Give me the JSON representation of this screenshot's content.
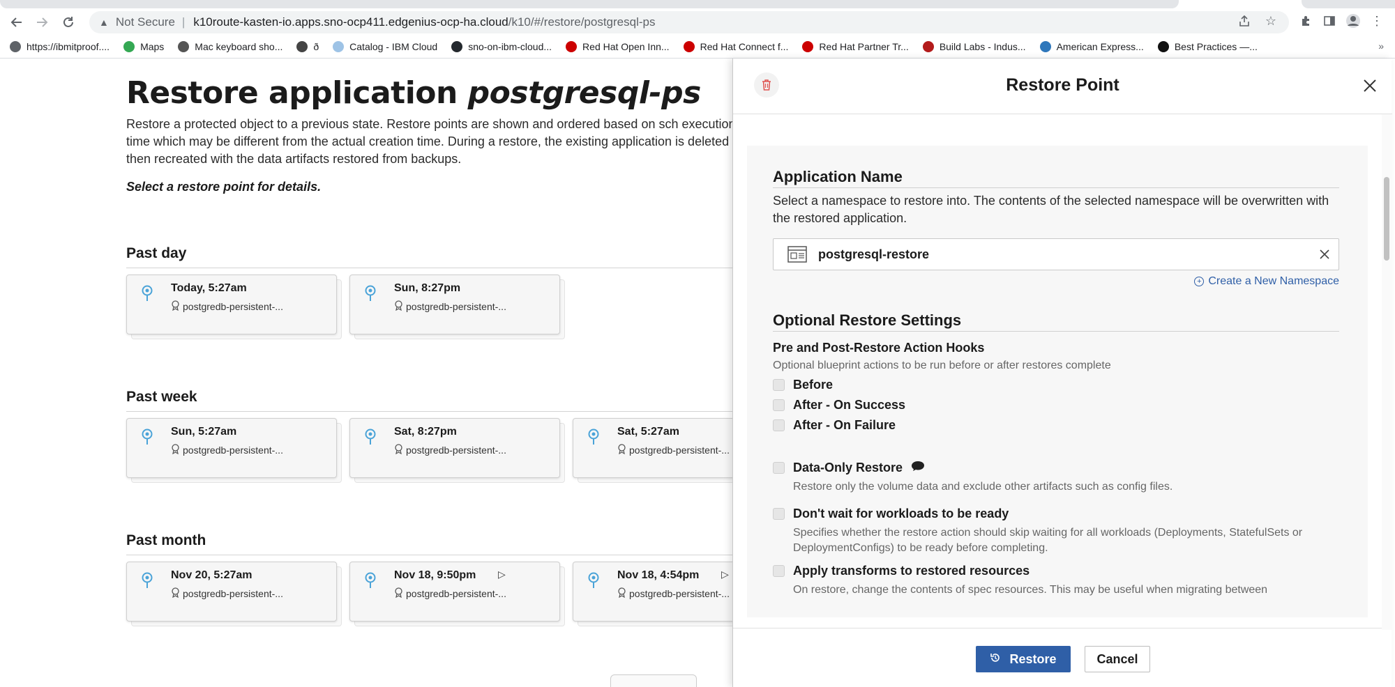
{
  "browser": {
    "security_label": "Not Secure",
    "url_host": "k10route-kasten-io.apps.sno-ocp411.edgenius-ocp-ha.cloud",
    "url_path": "/k10/#/restore/postgresql-ps",
    "bookmarks": [
      {
        "label": "https://ibmitproof....",
        "icon_color": "#5f6368"
      },
      {
        "label": "Maps",
        "icon_color": "#34a853"
      },
      {
        "label": "Mac keyboard sho...",
        "icon_color": "#555555"
      },
      {
        "label": "ð",
        "icon_color": "#444444"
      },
      {
        "label": "Catalog - IBM Cloud",
        "icon_color": "#9ec3e6"
      },
      {
        "label": "sno-on-ibm-cloud...",
        "icon_color": "#24292e"
      },
      {
        "label": "Red Hat Open Inn...",
        "icon_color": "#cc0000"
      },
      {
        "label": "Red Hat Connect f...",
        "icon_color": "#cc0000"
      },
      {
        "label": "Red Hat Partner Tr...",
        "icon_color": "#cc0000"
      },
      {
        "label": "Build Labs - Indus...",
        "icon_color": "#b31b1b"
      },
      {
        "label": "American Express...",
        "icon_color": "#2e77bb"
      },
      {
        "label": "Best Practices —...",
        "icon_color": "#111111"
      }
    ],
    "more_label": "»"
  },
  "page": {
    "title_prefix": "Restore application",
    "title_app": "postgresql-ps",
    "description": "Restore a protected object to a previous state. Restore points are shown and ordered based on sch execution time which may be different from the actual creation time. During a restore, the existing application is deleted and then recreated with the data artifacts restored from backups.",
    "select_hint": "Select a restore point for details.",
    "sections": [
      {
        "heading": "Past day",
        "cards": [
          {
            "time": "Today, 5:27am",
            "sub": "postgredb-persistent-...",
            "play": false
          },
          {
            "time": "Sun, 8:27pm",
            "sub": "postgredb-persistent-...",
            "play": false
          }
        ]
      },
      {
        "heading": "Past week",
        "cards": [
          {
            "time": "Sun, 5:27am",
            "sub": "postgredb-persistent-...",
            "play": false
          },
          {
            "time": "Sat, 8:27pm",
            "sub": "postgredb-persistent-...",
            "play": false
          },
          {
            "time": "Sat, 5:27am",
            "sub": "postgredb-persistent-...",
            "play": false
          }
        ]
      },
      {
        "heading": "Past month",
        "cards": [
          {
            "time": "Nov 20, 5:27am",
            "sub": "postgredb-persistent-...",
            "play": false
          },
          {
            "time": "Nov 18, 9:50pm",
            "sub": "postgredb-persistent-...",
            "play": true
          },
          {
            "time": "Nov 18, 4:54pm",
            "sub": "postgredb-persistent-...",
            "play": true
          }
        ]
      }
    ]
  },
  "panel": {
    "title": "Restore Point",
    "application_name": {
      "heading": "Application Name",
      "description": "Select a namespace to restore into. The contents of the selected namespace will be overwritten with the restored application.",
      "namespace_value": "postgresql-restore",
      "create_link": "Create a New Namespace"
    },
    "optional": {
      "heading": "Optional Restore Settings",
      "hooks_heading": "Pre and Post-Restore Action Hooks",
      "hooks_desc": "Optional blueprint actions to be run before or after restores complete",
      "hooks": [
        "Before",
        "After - On Success",
        "After - On Failure"
      ],
      "options": [
        {
          "label": "Data-Only Restore",
          "desc": "Restore only the volume data and exclude other artifacts such as config files.",
          "tip": true
        },
        {
          "label": "Don't wait for workloads to be ready",
          "desc": "Specifies whether the restore action should skip waiting for all workloads (Deployments, StatefulSets or DeploymentConfigs) to be ready before completing.",
          "tip": false
        },
        {
          "label": "Apply transforms to restored resources",
          "desc": "On restore, change the contents of spec resources. This may be useful when migrating between",
          "tip": false
        }
      ]
    },
    "footer": {
      "restore_label": "Restore",
      "cancel_label": "Cancel"
    }
  },
  "colors": {
    "primary": "#2f5fa7",
    "delete_icon": "#e0524f",
    "pin": "#4aa3d8"
  }
}
